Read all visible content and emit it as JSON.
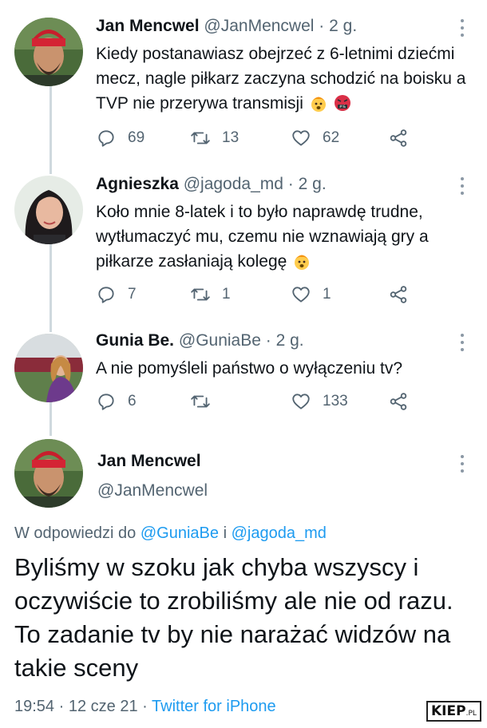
{
  "tweets": [
    {
      "name": "Jan Mencwel",
      "handle": "@JanMencwel",
      "separator": "·",
      "time": "2 g.",
      "text": "Kiedy postanawiasz obejrzeć z 6-letnimi dziećmi mecz, nagle piłkarz zaczyna schodzić na boisku a TVP nie przerywa transmisji",
      "emojis": [
        "exploding-head-emoji",
        "angry-cursing-face-emoji"
      ],
      "replies": "69",
      "retweets": "13",
      "likes": "62"
    },
    {
      "name": "Agnieszka",
      "handle": "@jagoda_md",
      "separator": "·",
      "time": "2 g.",
      "text": "Koło mnie 8-latek i to było naprawdę trudne, wytłumaczyć mu, czemu nie wznawiają gry a piłkarze zasłaniają kolegę",
      "emojis": [
        "exploding-head-emoji"
      ],
      "replies": "7",
      "retweets": "1",
      "likes": "1"
    },
    {
      "name": "Gunia Be.",
      "handle": "@GuniaBe",
      "separator": "·",
      "time": "2 g.",
      "text": "A nie pomyśleli państwo o wyłączeniu tv?",
      "emojis": [],
      "replies": "6",
      "retweets": "",
      "likes": "133"
    }
  ],
  "main_tweet": {
    "name": "Jan Mencwel",
    "handle": "@JanMencwel",
    "reply_prefix": "W odpowiedzi do",
    "reply_mention_1": "@GuniaBe",
    "reply_conjunction": "i",
    "reply_mention_2": "@jagoda_md",
    "text": "Byliśmy w szoku jak chyba wszyscy i oczywiście to zrobiliśmy ale nie od razu. To zadanie tv by nie narażać widzów na takie sceny",
    "time": "19:54",
    "separator": "·",
    "date": "12 cze 21",
    "separator2": "·",
    "source": "Twitter for iPhone"
  },
  "watermark": {
    "text": "KIEP",
    "suffix": ".PL"
  },
  "colors": {
    "text": "#0f1419",
    "secondary": "#536471",
    "link": "#1d9bf0",
    "thread_line": "#cfd9de"
  }
}
